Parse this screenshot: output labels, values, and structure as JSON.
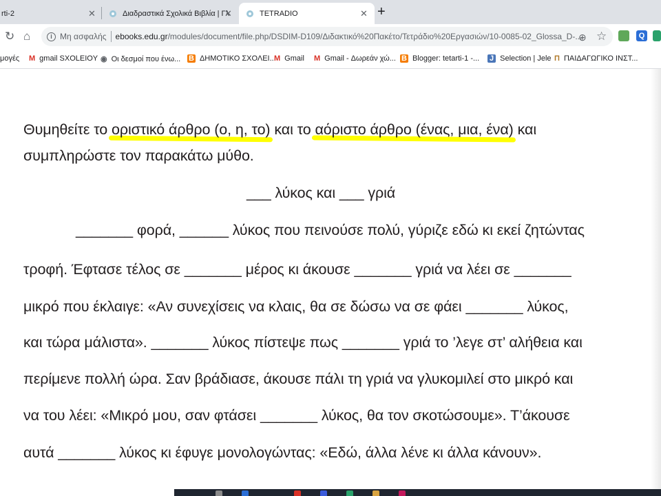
{
  "browser": {
    "tabs": [
      {
        "label": "rti-2"
      },
      {
        "label": "Διαδραστικά Σχολικά Βιβλία | Γλ"
      },
      {
        "label": "TETRADIO"
      }
    ],
    "new_tab": "+",
    "address": {
      "security": "Μη ασφαλής",
      "host": "ebooks.edu.gr",
      "path": "/modules/document/file.php/DSDIM-D109/Διδακτικό%20Πακέτο/Τετράδιο%20Εργασιών/10-0085-02_Glossa_D-..."
    },
    "bookmarks": [
      {
        "label": "μογές",
        "icon": ""
      },
      {
        "label": "gmail SXOLEIOY",
        "icon": "gmail-icon"
      },
      {
        "label": "Οι δεσμοί που ένω...",
        "icon": "globe-icon"
      },
      {
        "label": "ΔΗΜΟΤΙΚΟ ΣΧΟΛΕΙ...",
        "icon": "blogger-icon"
      },
      {
        "label": "Gmail",
        "icon": "gmail-icon"
      },
      {
        "label": "Gmail - Δωρεάν χώ...",
        "icon": "gmail-icon"
      },
      {
        "label": "Blogger: tetarti-1 -...",
        "icon": "blogger-icon"
      },
      {
        "label": "Selection | Jele",
        "icon": "j-icon"
      },
      {
        "label": "ΠΑΙΔΑΓΩΓΙΚΟ ΙΝΣΤ...",
        "icon": "pi-icon"
      }
    ]
  },
  "document": {
    "instruction": {
      "part1": "Θυμηθείτε το ",
      "hl1": "οριστικό άρθρο (ο, η, το)",
      "part2": " και το ",
      "hl2": "αόριστο άρθρο (ένας, μια, ένα)",
      "part3": " και",
      "line2": "συμπληρώστε τον παρακάτω μύθο."
    },
    "story_title": "___ λύκος και ___ γριά",
    "paragraph": [
      "_______ φορά, ______ λύκος  που πεινούσε πολύ, γύριζε εδώ κι εκεί ζητώντας",
      "τροφή.  Έφτασε τέλος σε _______ μέρος κι άκουσε _______ γριά να λέει σε _______",
      "μικρό που έκλαιγε: «Αν συνεχίσεις να κλαις, θα σε δώσω να σε φάει _______ λύκος,",
      "και τώρα μάλιστα». _______ λύκος πίστεψε πως _______ γριά το ’λεγε στ’ αλήθεια και",
      "περίμενε πολλή ώρα. Σαν βράδιασε, άκουσε πάλι τη γριά να γλυκομιλεί στο μικρό και",
      "να του λέει: «Μικρό μου, σαν φτάσει _______ λύκος, θα τον σκοτώσουμε». Τ’άκουσε",
      "αυτά _______ λύκος κι έφυγε μονολογώντας: «Εδώ, άλλα λένε κι άλλα κάνουν»."
    ],
    "highlight_color": "#ffff00"
  }
}
